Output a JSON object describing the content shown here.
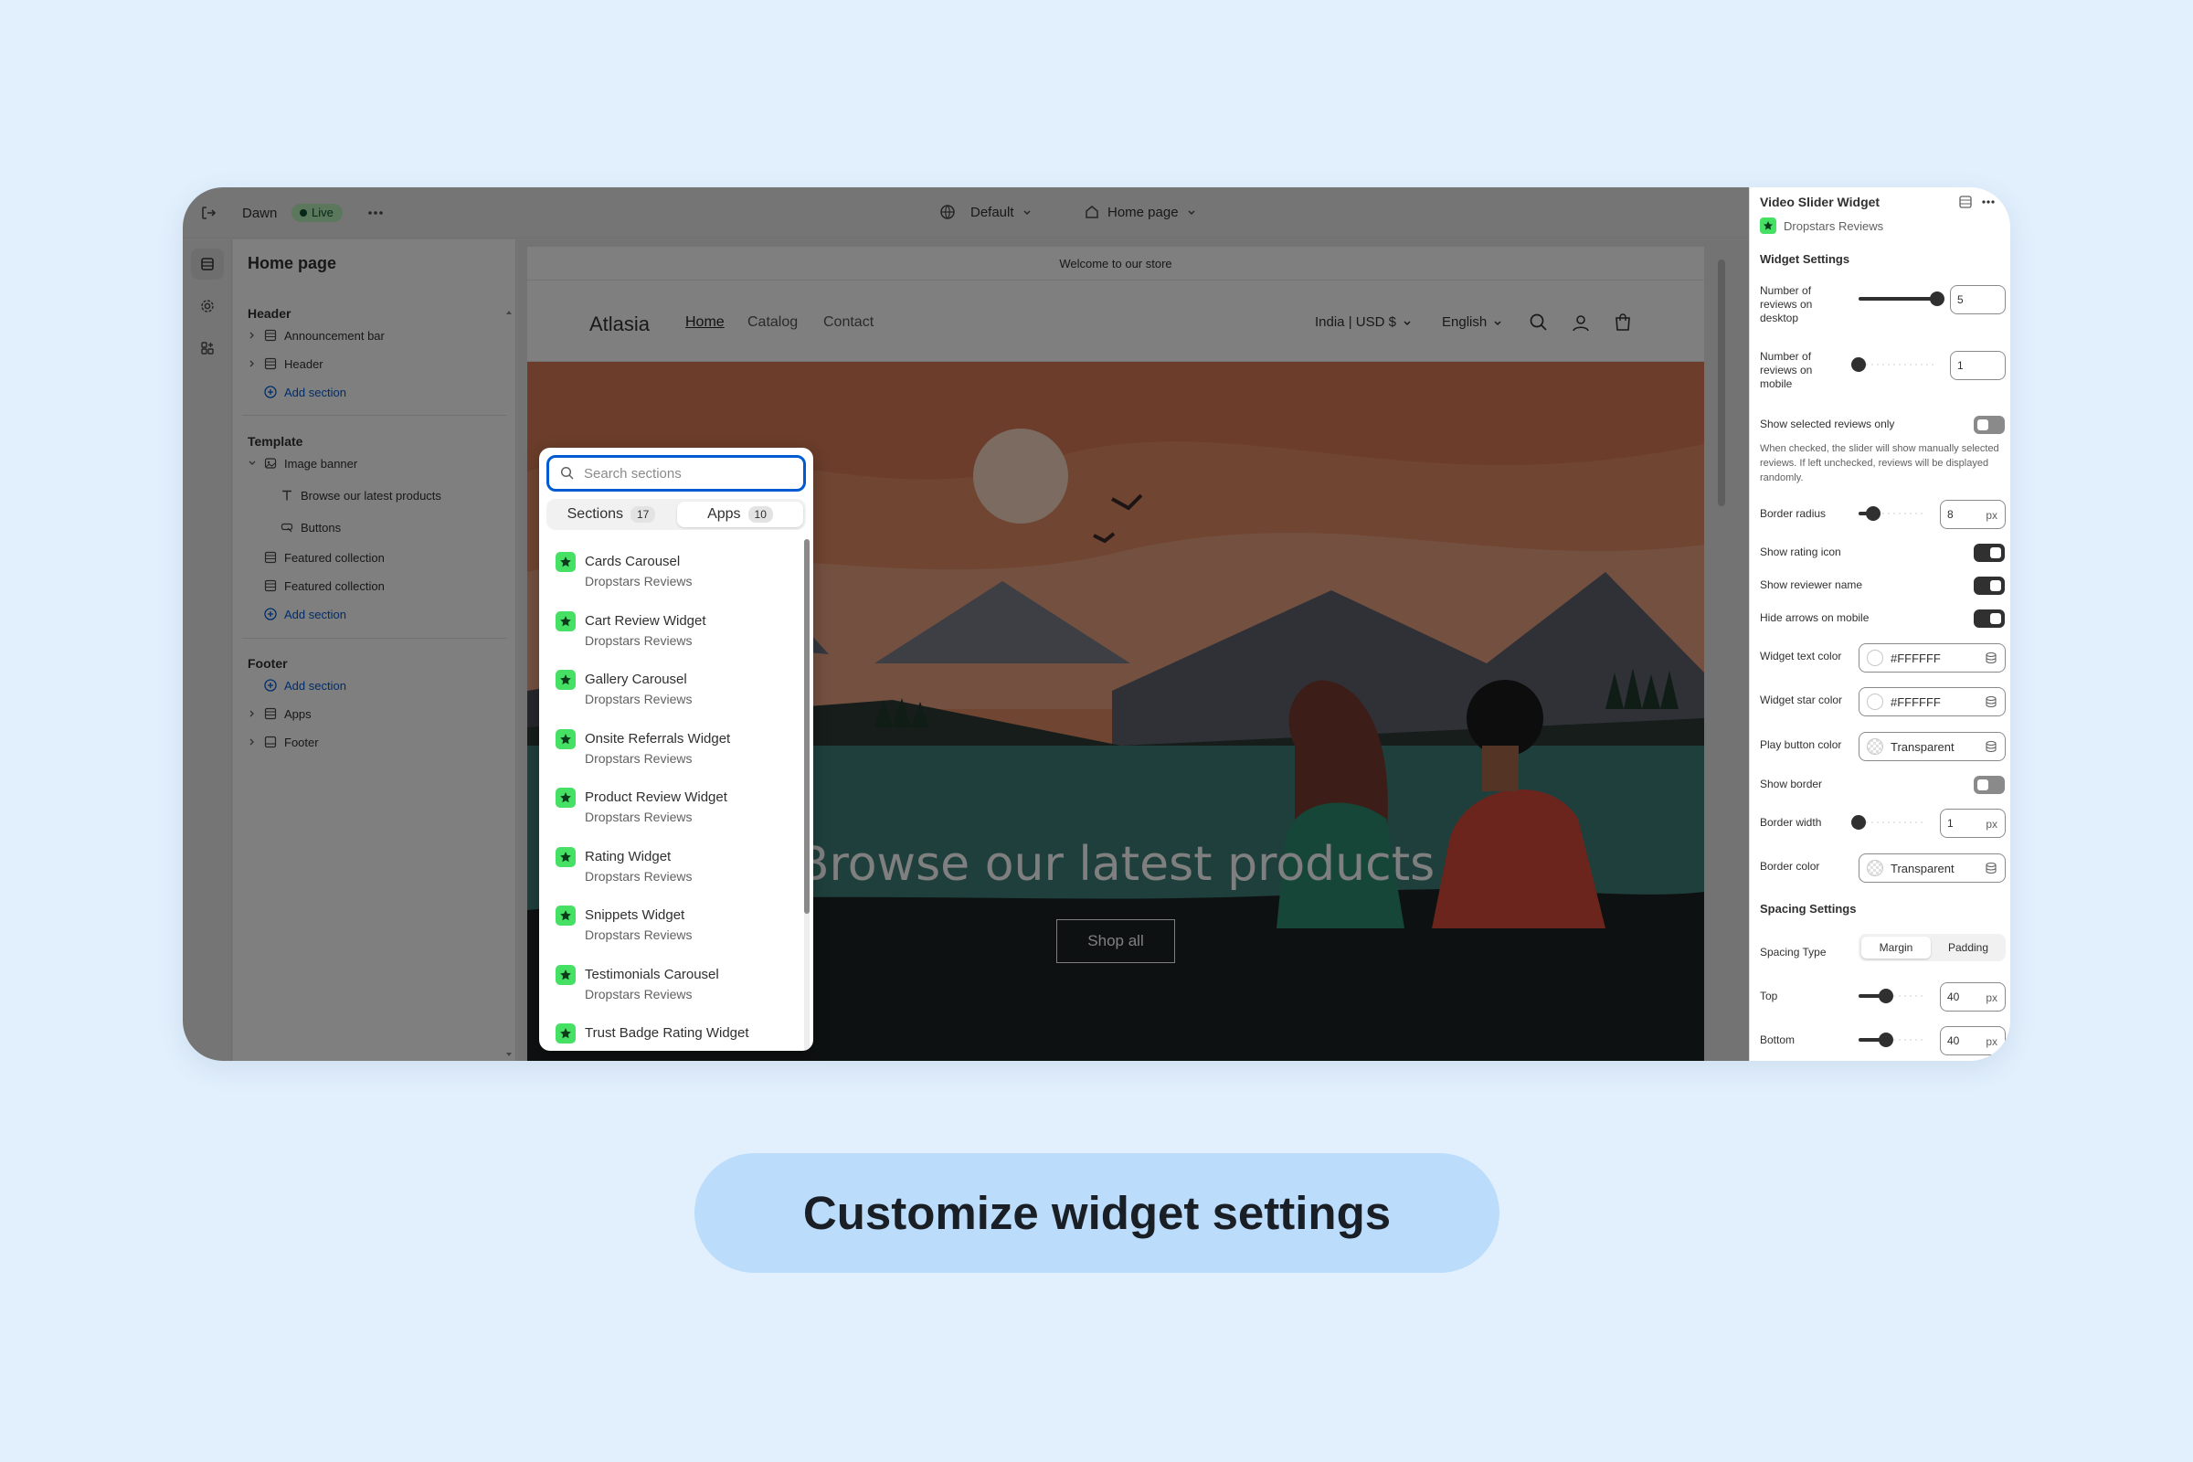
{
  "topbar": {
    "theme_name": "Dawn",
    "status_badge": "Live",
    "more_icon": "ellipsis-icon",
    "exit_icon": "exit-icon",
    "context_label": "Default",
    "page_label": "Home page"
  },
  "rail": {
    "icons": [
      "sections-icon",
      "settings-gear-icon",
      "apps-icon"
    ]
  },
  "tree": {
    "title": "Home page",
    "header_group": "Header",
    "header_items": [
      "Announcement bar",
      "Header"
    ],
    "add_section": "Add section",
    "template_group": "Template",
    "template_items": [
      "Image banner",
      "Browse our latest products",
      "Buttons",
      "Featured collection",
      "Featured collection"
    ],
    "footer_group": "Footer",
    "footer_items": [
      "Apps",
      "Footer"
    ]
  },
  "store": {
    "announcement": "Welcome to our store",
    "logo": "Atlasia",
    "nav": [
      "Home",
      "Catalog",
      "Contact"
    ],
    "locale": "India | USD $",
    "language": "English",
    "hero_title": "Browse our latest products",
    "hero_button": "Shop all"
  },
  "picker": {
    "search_placeholder": "Search sections",
    "tab_sections": "Sections",
    "tab_sections_count": "17",
    "tab_apps": "Apps",
    "tab_apps_count": "10",
    "active_tab": "Apps",
    "apps": [
      {
        "name": "Cards Carousel",
        "vendor": "Dropstars Reviews"
      },
      {
        "name": "Cart Review Widget",
        "vendor": "Dropstars Reviews"
      },
      {
        "name": "Gallery Carousel",
        "vendor": "Dropstars Reviews"
      },
      {
        "name": "Onsite Referrals Widget",
        "vendor": "Dropstars Reviews"
      },
      {
        "name": "Product Review Widget",
        "vendor": "Dropstars Reviews"
      },
      {
        "name": "Rating Widget",
        "vendor": "Dropstars Reviews"
      },
      {
        "name": "Snippets Widget",
        "vendor": "Dropstars Reviews"
      },
      {
        "name": "Testimonials Carousel",
        "vendor": "Dropstars Reviews"
      },
      {
        "name": "Trust Badge Rating Widget",
        "vendor": ""
      }
    ]
  },
  "settings": {
    "title": "Video Slider Widget",
    "app_name": "Dropstars Reviews",
    "widget_settings_header": "Widget Settings",
    "reviews_desktop_label": "Number of reviews on desktop",
    "reviews_desktop_value": "5",
    "reviews_desktop_fraction": 1.0,
    "reviews_mobile_label": "Number of reviews on mobile",
    "reviews_mobile_value": "1",
    "reviews_mobile_fraction": 0.0,
    "selected_only_label": "Show selected reviews only",
    "selected_only_on": false,
    "selected_only_note": "When checked, the slider will show manually selected reviews. If left unchecked, reviews will be displayed randomly.",
    "border_radius_label": "Border radius",
    "border_radius_value": "8",
    "border_radius_fraction": 0.22,
    "unit_px": "px",
    "rating_icon_label": "Show rating icon",
    "rating_icon_on": true,
    "reviewer_name_label": "Show reviewer name",
    "reviewer_name_on": true,
    "hide_arrows_label": "Hide arrows on mobile",
    "hide_arrows_on": true,
    "text_color_label": "Widget text color",
    "text_color_value": "#FFFFFF",
    "star_color_label": "Widget star color",
    "star_color_value": "#FFFFFF",
    "play_color_label": "Play button color",
    "play_color_value": "Transparent",
    "show_border_label": "Show border",
    "show_border_on": false,
    "border_width_label": "Border width",
    "border_width_value": "1",
    "border_width_fraction": 0.0,
    "border_color_label": "Border color",
    "border_color_value": "Transparent",
    "spacing_header": "Spacing Settings",
    "spacing_type_label": "Spacing Type",
    "spacing_opt_margin": "Margin",
    "spacing_opt_padding": "Padding",
    "spacing_selected": "Margin",
    "top_label": "Top",
    "top_value": "40",
    "top_fraction": 0.4,
    "bottom_label": "Bottom",
    "bottom_value": "40",
    "bottom_fraction": 0.4
  },
  "caption": "Customize widget settings",
  "colors": {
    "background": "#e2f0fd",
    "caption_pill": "#bbdcfa",
    "link_blue": "#005bd3",
    "app_green": "#45e064",
    "live_badge": "#b6eeb8"
  }
}
